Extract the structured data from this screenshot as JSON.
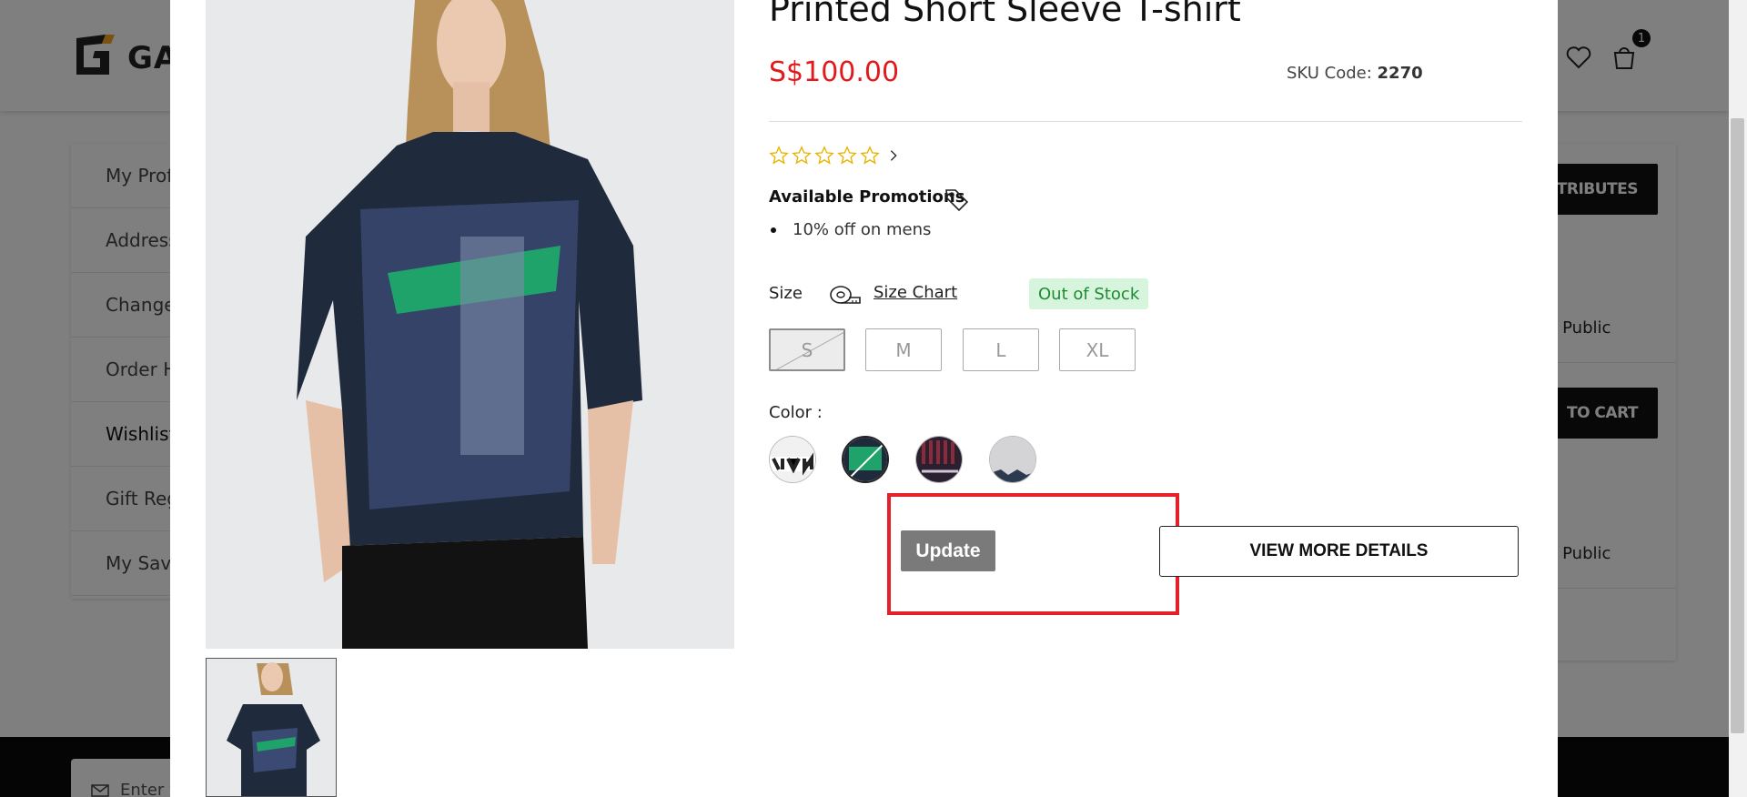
{
  "background": {
    "brand_text": "GAU",
    "cart_count": "1",
    "account_menu": [
      {
        "label": "My Profile"
      },
      {
        "label": "Address Book"
      },
      {
        "label": "Change Password"
      },
      {
        "label": "Order History"
      },
      {
        "label": "Wishlist"
      },
      {
        "label": "Gift Registry"
      },
      {
        "label": "My Saved Cards"
      }
    ],
    "right_panel": {
      "attributes_button": "TRIBUTES",
      "item1_text": "n Public",
      "add_to_cart_button": "TO CART",
      "item2_text": "n Public"
    },
    "footer_input_placeholder": "Enter y"
  },
  "modal": {
    "title": "Printed Short Sleeve T-shirt",
    "price": "S$100.00",
    "sku_label": "SKU Code:",
    "sku_value": "2270",
    "rating_stars": 0,
    "rating_max": 5,
    "promotions_title": "Available Promotions",
    "promotions": [
      "10% off on mens"
    ],
    "size_label": "Size",
    "size_chart_link": "Size Chart",
    "stock_status": "Out of Stock",
    "sizes": [
      {
        "label": "S",
        "disabled": true
      },
      {
        "label": "M",
        "disabled": false
      },
      {
        "label": "L",
        "disabled": false
      },
      {
        "label": "XL",
        "disabled": false
      }
    ],
    "color_label": "Color :",
    "color_swatches": [
      {
        "name": "white-print",
        "selected": false
      },
      {
        "name": "green-print",
        "selected": true
      },
      {
        "name": "maroon-print",
        "selected": false
      },
      {
        "name": "grey-print",
        "selected": false
      }
    ],
    "update_button": "Update",
    "view_details_button": "VIEW MORE DETAILS"
  },
  "colors": {
    "price": "#e11b1b",
    "stock_bg": "#d7f5dc",
    "stock_text": "#1e8a34",
    "highlight": "#e5202b",
    "star_outline": "#e8b400"
  }
}
